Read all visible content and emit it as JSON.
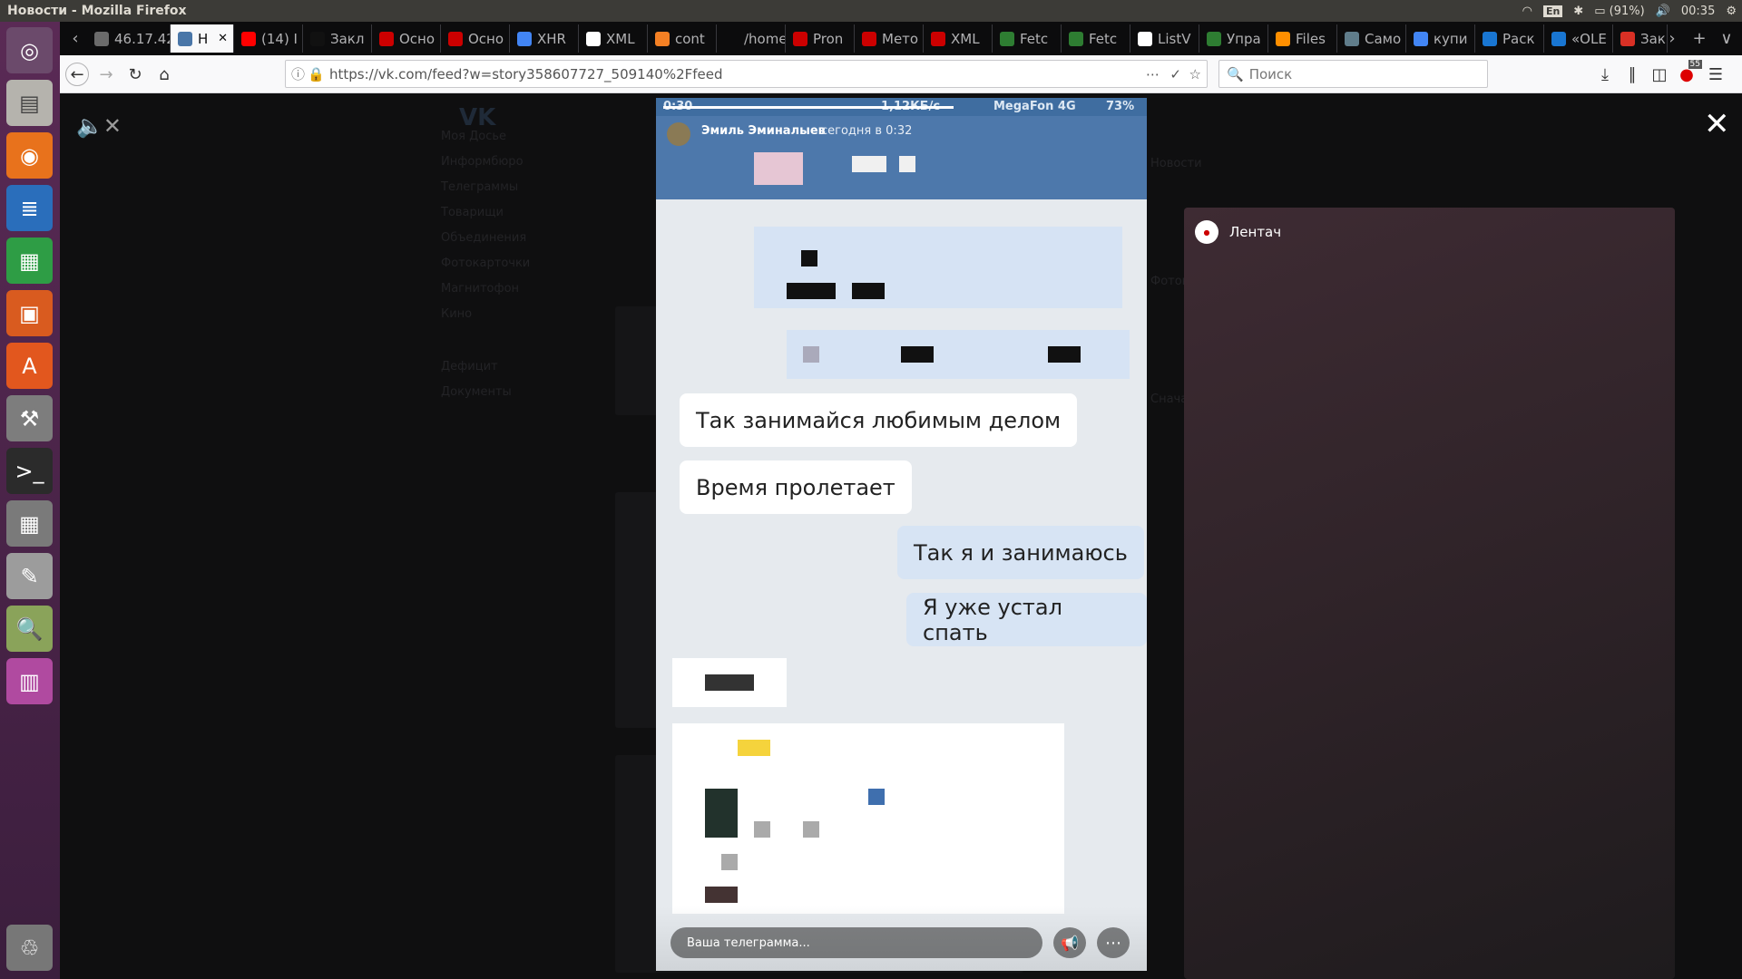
{
  "system": {
    "window_title": "Новости - Mozilla Firefox",
    "keyboard_layout": "En",
    "battery": "(91%)",
    "time": "00:35"
  },
  "tabs": [
    {
      "label": "46.17.42",
      "color": "#6b6b6b"
    },
    {
      "label": "Н",
      "color": "#4a76a8",
      "active": true
    },
    {
      "label": "(14) I",
      "color": "#ff0000"
    },
    {
      "label": "Закл",
      "color": "#111111"
    },
    {
      "label": "Осно",
      "color": "#cc0000"
    },
    {
      "label": "Осно",
      "color": "#cc0000"
    },
    {
      "label": "XHR",
      "color": "#4285f4"
    },
    {
      "label": "XML",
      "color": "#ffffff"
    },
    {
      "label": "cont",
      "color": "#f48024"
    },
    {
      "label": "/home/",
      "color": "#0c0c0d"
    },
    {
      "label": "Pron",
      "color": "#cc0000"
    },
    {
      "label": "Мето",
      "color": "#cc0000"
    },
    {
      "label": "XML",
      "color": "#cc0000"
    },
    {
      "label": "Fetc",
      "color": "#2e7d32"
    },
    {
      "label": "Fetc",
      "color": "#2e7d32"
    },
    {
      "label": "ListV",
      "color": "#ffffff"
    },
    {
      "label": "Упра",
      "color": "#2e7d32"
    },
    {
      "label": "Files",
      "color": "#ff8f00"
    },
    {
      "label": "Само",
      "color": "#607d8b"
    },
    {
      "label": "купи",
      "color": "#4285f4"
    },
    {
      "label": "Раск",
      "color": "#1976d2"
    },
    {
      "label": "«OLE",
      "color": "#1976d2"
    },
    {
      "label": "Зак",
      "color": "#d93025"
    }
  ],
  "navbar": {
    "url": "https://vk.com/feed?w=story358607727_509140%2Ffeed",
    "search_placeholder": "Поиск",
    "notification_count": "55"
  },
  "story": {
    "phone_status_left": "0:30",
    "phone_status_center": "1,12КБ/с",
    "phone_status_right": "MegaFon 4G",
    "phone_battery": "73%",
    "author": "Эмиль Эминалыев",
    "time": "сегодня в 0:32",
    "messages": [
      {
        "text": "Так занимайся любимым делом",
        "side": "in"
      },
      {
        "text": "Время пролетает",
        "side": "in"
      },
      {
        "text": "Так я и занимаюсь",
        "side": "out"
      },
      {
        "text": "Я уже устал спать",
        "side": "out"
      }
    ],
    "reply_placeholder": "Ваша телеграмма..."
  },
  "side_story": {
    "author": "Лентач"
  },
  "vk_background": {
    "menu": [
      "Моя Досье",
      "Информбюро",
      "Телеграммы",
      "Товарищи",
      "Объединения",
      "Фотокарточки",
      "Магнитофон",
      "Кино",
      "Дефицит",
      "Документы"
    ],
    "right_menu": [
      "Новости",
      "Фотокарточки",
      "Сначала"
    ]
  },
  "colors": {
    "vk_blue": "#4d78ab",
    "bubble_out": "#d7e4f4"
  }
}
